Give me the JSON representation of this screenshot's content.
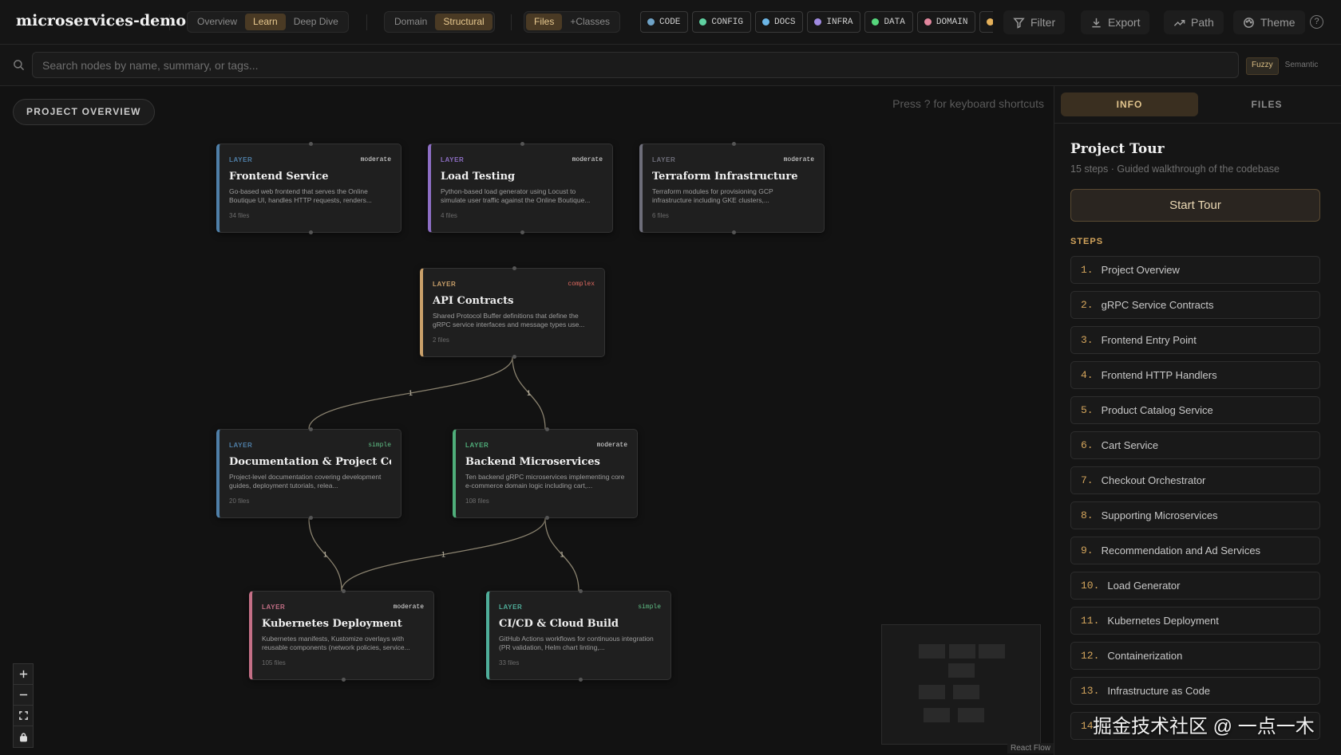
{
  "app": {
    "title": "microservices-demo"
  },
  "view_modes": [
    {
      "label": "Overview",
      "active": false
    },
    {
      "label": "Learn",
      "active": true
    },
    {
      "label": "Deep Dive",
      "active": false
    }
  ],
  "lens": [
    {
      "label": "Domain",
      "active": false
    },
    {
      "label": "Structural",
      "active": true
    }
  ],
  "granularity": [
    {
      "label": "Files",
      "active": true
    },
    {
      "label": "+Classes",
      "active": false
    }
  ],
  "categories": [
    {
      "label": "CODE",
      "color": "#6fa3c7"
    },
    {
      "label": "CONFIG",
      "color": "#5fd0a0"
    },
    {
      "label": "DOCS",
      "color": "#6cb6e6"
    },
    {
      "label": "INFRA",
      "color": "#a08ae0"
    },
    {
      "label": "DATA",
      "color": "#56d67c"
    },
    {
      "label": "DOMAIN",
      "color": "#e2879e"
    },
    {
      "label": "",
      "color": "#e4b05a"
    }
  ],
  "toolbar": {
    "filter_label": "Filter",
    "export_label": "Export",
    "path_label": "Path",
    "theme_label": "Theme",
    "help_label": "?"
  },
  "search": {
    "placeholder": "Search nodes by name, summary, or tags...",
    "modes": [
      {
        "label": "Fuzzy",
        "active": true
      },
      {
        "label": "Semantic",
        "active": false
      }
    ]
  },
  "canvas": {
    "overview_label": "PROJECT OVERVIEW",
    "keyboard_hint": "Press ? for keyboard shortcuts",
    "attribution": "React Flow"
  },
  "nodes": [
    {
      "id": "frontend",
      "type": "LAYER",
      "complexity": "moderate",
      "title": "Frontend Service",
      "summary": "Go-based web frontend that serves the Online Boutique UI, handles HTTP requests, renders...",
      "files": "34 files",
      "color": "#4f7fa8"
    },
    {
      "id": "loadtest",
      "type": "LAYER",
      "complexity": "moderate",
      "title": "Load Testing",
      "summary": "Python-based load generator using Locust to simulate user traffic against the Online Boutique...",
      "files": "4 files",
      "color": "#8d6ec4"
    },
    {
      "id": "terraform",
      "type": "LAYER",
      "complexity": "moderate",
      "title": "Terraform Infrastructure",
      "summary": "Terraform modules for provisioning GCP infrastructure including GKE clusters,...",
      "files": "6 files",
      "color": "#6e6e7a"
    },
    {
      "id": "api",
      "type": "LAYER",
      "complexity": "complex",
      "title": "API Contracts",
      "summary": "Shared Protocol Buffer definitions that define the gRPC service interfaces and message types use...",
      "files": "2 files",
      "color": "#c9a06a"
    },
    {
      "id": "docs",
      "type": "LAYER",
      "complexity": "simple",
      "title": "Documentation & Project Config",
      "summary": "Project-level documentation covering development guides, deployment tutorials, relea...",
      "files": "20 files",
      "color": "#4f7fa8"
    },
    {
      "id": "backend",
      "type": "LAYER",
      "complexity": "moderate",
      "title": "Backend Microservices",
      "summary": "Ten backend gRPC microservices implementing core e-commerce domain logic including cart,...",
      "files": "108 files",
      "color": "#4fae7a"
    },
    {
      "id": "k8s",
      "type": "LAYER",
      "complexity": "moderate",
      "title": "Kubernetes Deployment",
      "summary": "Kubernetes manifests, Kustomize overlays with reusable components (network policies, service...",
      "files": "105 files",
      "color": "#c46f86"
    },
    {
      "id": "cicd",
      "type": "LAYER",
      "complexity": "simple",
      "title": "CI/CD & Cloud Build",
      "summary": "GitHub Actions workflows for continuous integration (PR validation, Helm chart linting,...",
      "files": "33 files",
      "color": "#4fae9a"
    }
  ],
  "edges": [
    {
      "from": "api",
      "to": "docs",
      "label": "1"
    },
    {
      "from": "api",
      "to": "backend",
      "label": "1"
    },
    {
      "from": "docs",
      "to": "k8s",
      "label": "1"
    },
    {
      "from": "backend",
      "to": "k8s",
      "label": "1"
    },
    {
      "from": "backend",
      "to": "cicd",
      "label": "1"
    }
  ],
  "panel": {
    "tabs": [
      {
        "label": "INFO",
        "active": true
      },
      {
        "label": "FILES",
        "active": false
      }
    ],
    "tour_title": "Project Tour",
    "tour_subtitle": "15 steps · Guided walkthrough of the codebase",
    "start_label": "Start Tour",
    "steps_label": "STEPS",
    "steps": [
      {
        "num": "1.",
        "label": "Project Overview"
      },
      {
        "num": "2.",
        "label": "gRPC Service Contracts"
      },
      {
        "num": "3.",
        "label": "Frontend Entry Point"
      },
      {
        "num": "4.",
        "label": "Frontend HTTP Handlers"
      },
      {
        "num": "5.",
        "label": "Product Catalog Service"
      },
      {
        "num": "6.",
        "label": "Cart Service"
      },
      {
        "num": "7.",
        "label": "Checkout Orchestrator"
      },
      {
        "num": "8.",
        "label": "Supporting Microservices"
      },
      {
        "num": "9.",
        "label": "Recommendation and Ad Services"
      },
      {
        "num": "10.",
        "label": "Load Generator"
      },
      {
        "num": "11.",
        "label": "Kubernetes Deployment"
      },
      {
        "num": "12.",
        "label": "Containerization"
      },
      {
        "num": "13.",
        "label": "Infrastructure as Code"
      },
      {
        "num": "14",
        "label": ""
      }
    ]
  },
  "watermark": "掘金技术社区 @ 一点一木"
}
